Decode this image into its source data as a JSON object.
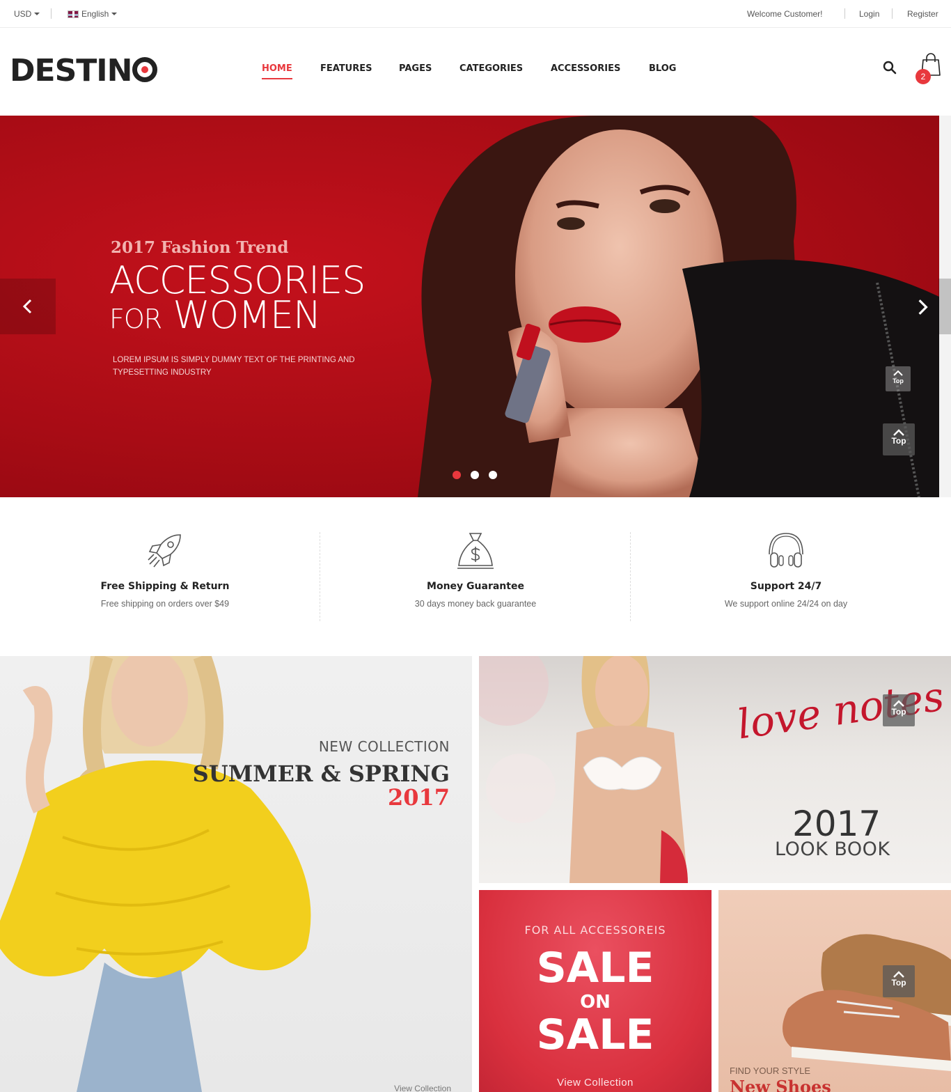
{
  "topbar": {
    "currency": "USD",
    "language": "English",
    "welcome": "Welcome Customer!",
    "login": "Login",
    "register": "Register"
  },
  "header": {
    "logo": "DESTINO",
    "nav": [
      "HOME",
      "FEATURES",
      "PAGES",
      "CATEGORIES",
      "ACCESSORIES",
      "BLOG"
    ],
    "active_nav": "HOME",
    "cart_count": "2"
  },
  "hero": {
    "subtitle": "2017 Fashion Trend",
    "title_line1": "ACCESSORIES",
    "title_line2_small": "FOR",
    "title_line2_big": "WOMEN",
    "description": "LOREM IPSUM IS SIMPLY DUMMY TEXT OF THE PRINTING AND TYPESETTING INDUSTRY",
    "slide_count": 3,
    "active_slide": 1
  },
  "features": [
    {
      "icon": "rocket-icon",
      "title": "Free Shipping & Return",
      "desc": "Free shipping on orders over $49"
    },
    {
      "icon": "money-bag-icon",
      "title": "Money Guarantee",
      "desc": "30 days money back guarantee"
    },
    {
      "icon": "headphones-icon",
      "title": "Support 24/7",
      "desc": "We support online 24/24 on day"
    }
  ],
  "banners": {
    "summer": {
      "kicker": "NEW COLLECTION",
      "title": "SUMMER & SPRING",
      "year": "2017",
      "link": "View Collection"
    },
    "lookbook": {
      "script": "love notes",
      "year": "2017",
      "title": "LOOK BOOK"
    },
    "sale": {
      "kicker": "FOR ALL ACCESSOREIS",
      "line1": "SALE",
      "line2": "ON",
      "line3": "SALE",
      "link": "View Collection"
    },
    "shoes": {
      "kicker": "FIND YOUR STYLE",
      "title": "New Shoes"
    }
  },
  "back_to_top": "Top",
  "colors": {
    "accent": "#e8383d",
    "hero_red": "#b00e17",
    "text_dark": "#222222"
  }
}
